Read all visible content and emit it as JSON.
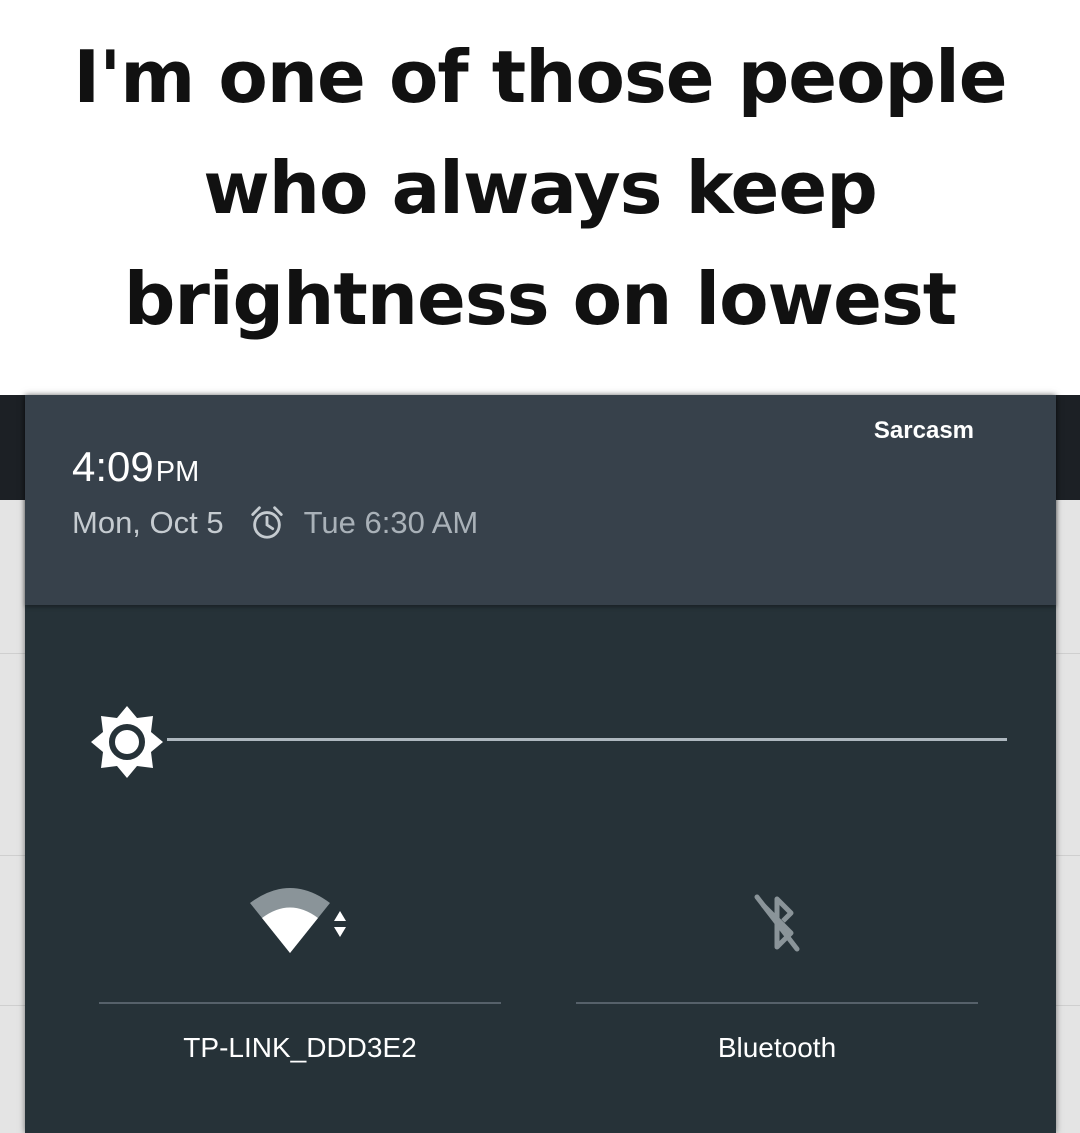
{
  "caption": {
    "text": "I'm one of those people who always keep brightness on lowest"
  },
  "status": {
    "carrier": "Sarcasm",
    "time": "4:09",
    "ampm": "PM",
    "date": "Mon, Oct 5",
    "alarm_icon": "alarm-clock-icon",
    "alarm_time": "Tue 6:30 AM"
  },
  "brightness": {
    "icon": "brightness-sun-icon",
    "level": 0.0
  },
  "tiles": [
    {
      "icon": "wifi-icon",
      "label": "TP-LINK_DDD3E2"
    },
    {
      "icon": "bluetooth-disabled-icon",
      "label": "Bluetooth"
    }
  ],
  "colors": {
    "shade_bg": "#263238",
    "header_bg": "#37414b",
    "text_primary": "#ffffff",
    "text_secondary": "#c5cbd0"
  }
}
